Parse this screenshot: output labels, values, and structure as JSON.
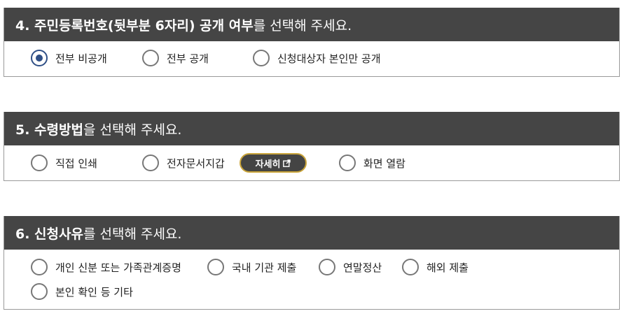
{
  "q4": {
    "number_title": "4. 주민등록번호(뒷부분 6자리) 공개 여부",
    "suffix": "를 선택해 주세요.",
    "options": [
      "전부 비공개",
      "전부 공개",
      "신청대상자 본인만 공개"
    ],
    "selected": "전부 비공개"
  },
  "q5": {
    "number_title": "5. 수령방법",
    "suffix": "을 선택해 주세요.",
    "options": [
      "직접 인쇄",
      "전자문서지갑",
      "화면 열람"
    ],
    "detail_button": "자세히",
    "selected": ""
  },
  "q6": {
    "number_title": "6. 신청사유",
    "suffix": "를 선택해 주세요.",
    "options": [
      "개인 신분 또는 가족관계증명",
      "국내 기관 제출",
      "연말정산",
      "해외 제출",
      "본인 확인 등 기타"
    ],
    "selected": ""
  },
  "colors": {
    "header_bg": "#454545",
    "radio_selected": "#2f4f86",
    "detail_button_border": "#c9a43a"
  }
}
